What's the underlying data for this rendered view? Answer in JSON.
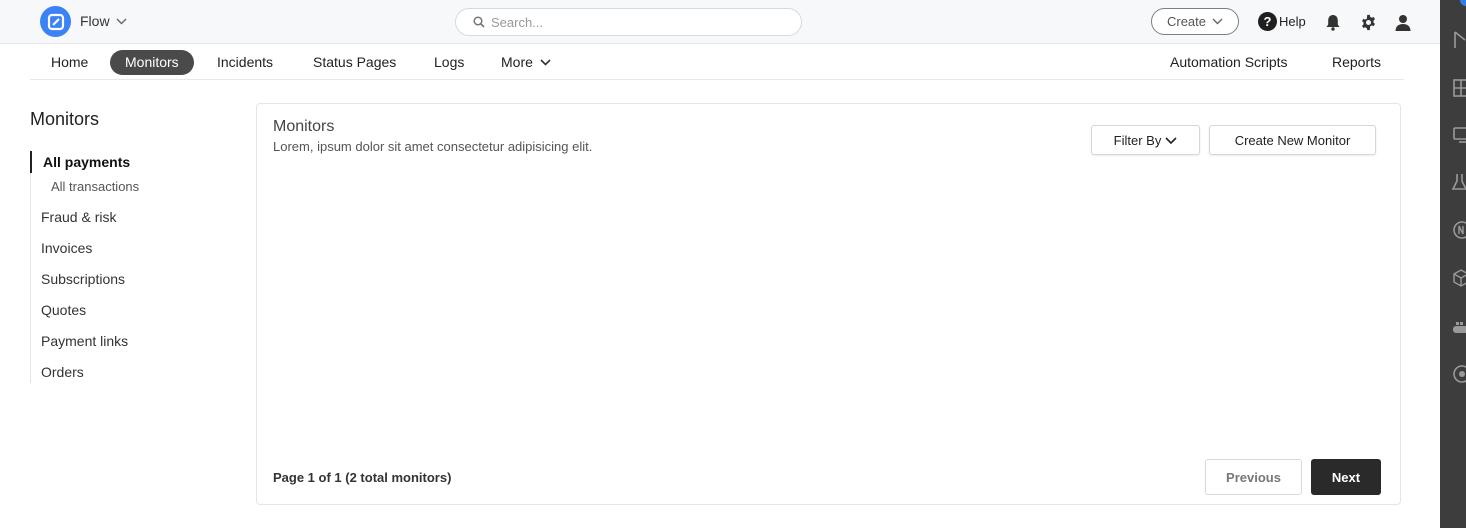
{
  "header": {
    "app_name": "Flow",
    "search_placeholder": "Search...",
    "create_label": "Create",
    "help_label": "Help",
    "help_symbol": "?",
    "icons": [
      "logo-icon",
      "search-icon",
      "bell-icon",
      "gear-icon",
      "user-icon"
    ]
  },
  "nav": {
    "items": [
      {
        "label": "Home",
        "active": false
      },
      {
        "label": "Monitors",
        "active": true
      },
      {
        "label": "Incidents",
        "active": false
      },
      {
        "label": "Status Pages",
        "active": false
      },
      {
        "label": "Logs",
        "active": false
      },
      {
        "label": "More",
        "active": false
      }
    ],
    "right_items": [
      {
        "label": "Automation Scripts"
      },
      {
        "label": "Reports"
      }
    ]
  },
  "sidebar": {
    "title": "Monitors",
    "items": [
      {
        "label": "All payments",
        "active": true
      },
      {
        "label": "All transactions",
        "sub": true
      },
      {
        "label": "Fraud & risk"
      },
      {
        "label": "Invoices"
      },
      {
        "label": "Subscriptions"
      },
      {
        "label": "Quotes"
      },
      {
        "label": "Payment links"
      },
      {
        "label": "Orders"
      }
    ]
  },
  "main": {
    "title": "Monitors",
    "description": "Lorem, ipsum dolor sit amet consectetur adipisicing elit.",
    "filter_label": "Filter By",
    "create_monitor_label": "Create New Monitor",
    "page_info": "Page 1 of 1 (2 total monitors)",
    "previous_label": "Previous",
    "next_label": "Next"
  },
  "colors": {
    "accent": "#3b82f6",
    "active_nav": "#4a4a4a",
    "primary_button": "#2a2a2a",
    "right_rail": "#3d3d3d"
  }
}
